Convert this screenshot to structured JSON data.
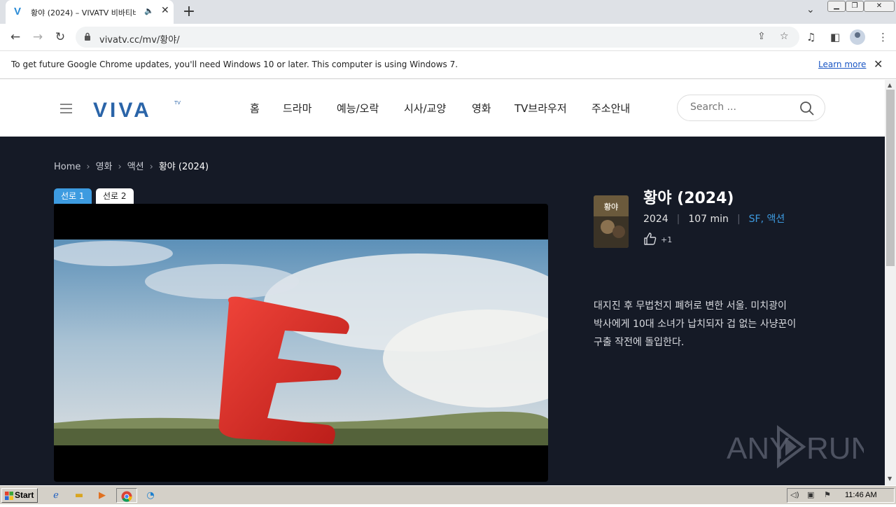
{
  "browser": {
    "tab_title": "황야 (2024) – VIVATV 비바티비",
    "tab_favicon_letter": "V",
    "url": "vivatv.cc/mv/황야/",
    "new_tab_label": "+",
    "infobar_text": "To get future Google Chrome updates, you'll need Windows 10 or later. This computer is using Windows 7.",
    "infobar_link": "Learn more"
  },
  "site": {
    "logo_text": "VIVA",
    "logo_sup": "TV",
    "nav": [
      "홈",
      "드라마",
      "예능/오락",
      "시사/교양",
      "영화",
      "TV브라우저",
      "주소안내"
    ],
    "search_placeholder": "Search ..."
  },
  "breadcrumb": [
    "Home",
    "영화",
    "액션",
    "황야 (2024)"
  ],
  "servers": [
    "선로 1",
    "선로 2"
  ],
  "movie": {
    "title": "황야 (2024)",
    "year": "2024",
    "runtime": "107 min",
    "genres": [
      "SF",
      "액션"
    ],
    "likes": "+1",
    "synopsis": "대지진 후 무법천지 폐허로 변한 서울. 미치광이 박사에게 10대 소녀가 납치되자 겁 없는 사냥꾼이 구출 작전에 돌입한다.",
    "poster_text": "황야"
  },
  "watermark": {
    "left": "ANY",
    "right": "RUN"
  },
  "taskbar": {
    "start_label": "Start",
    "clock": "11:46 AM"
  },
  "colors": {
    "accent": "#3d9be0",
    "main_bg": "#151a26",
    "logo": "#2a64a8"
  }
}
